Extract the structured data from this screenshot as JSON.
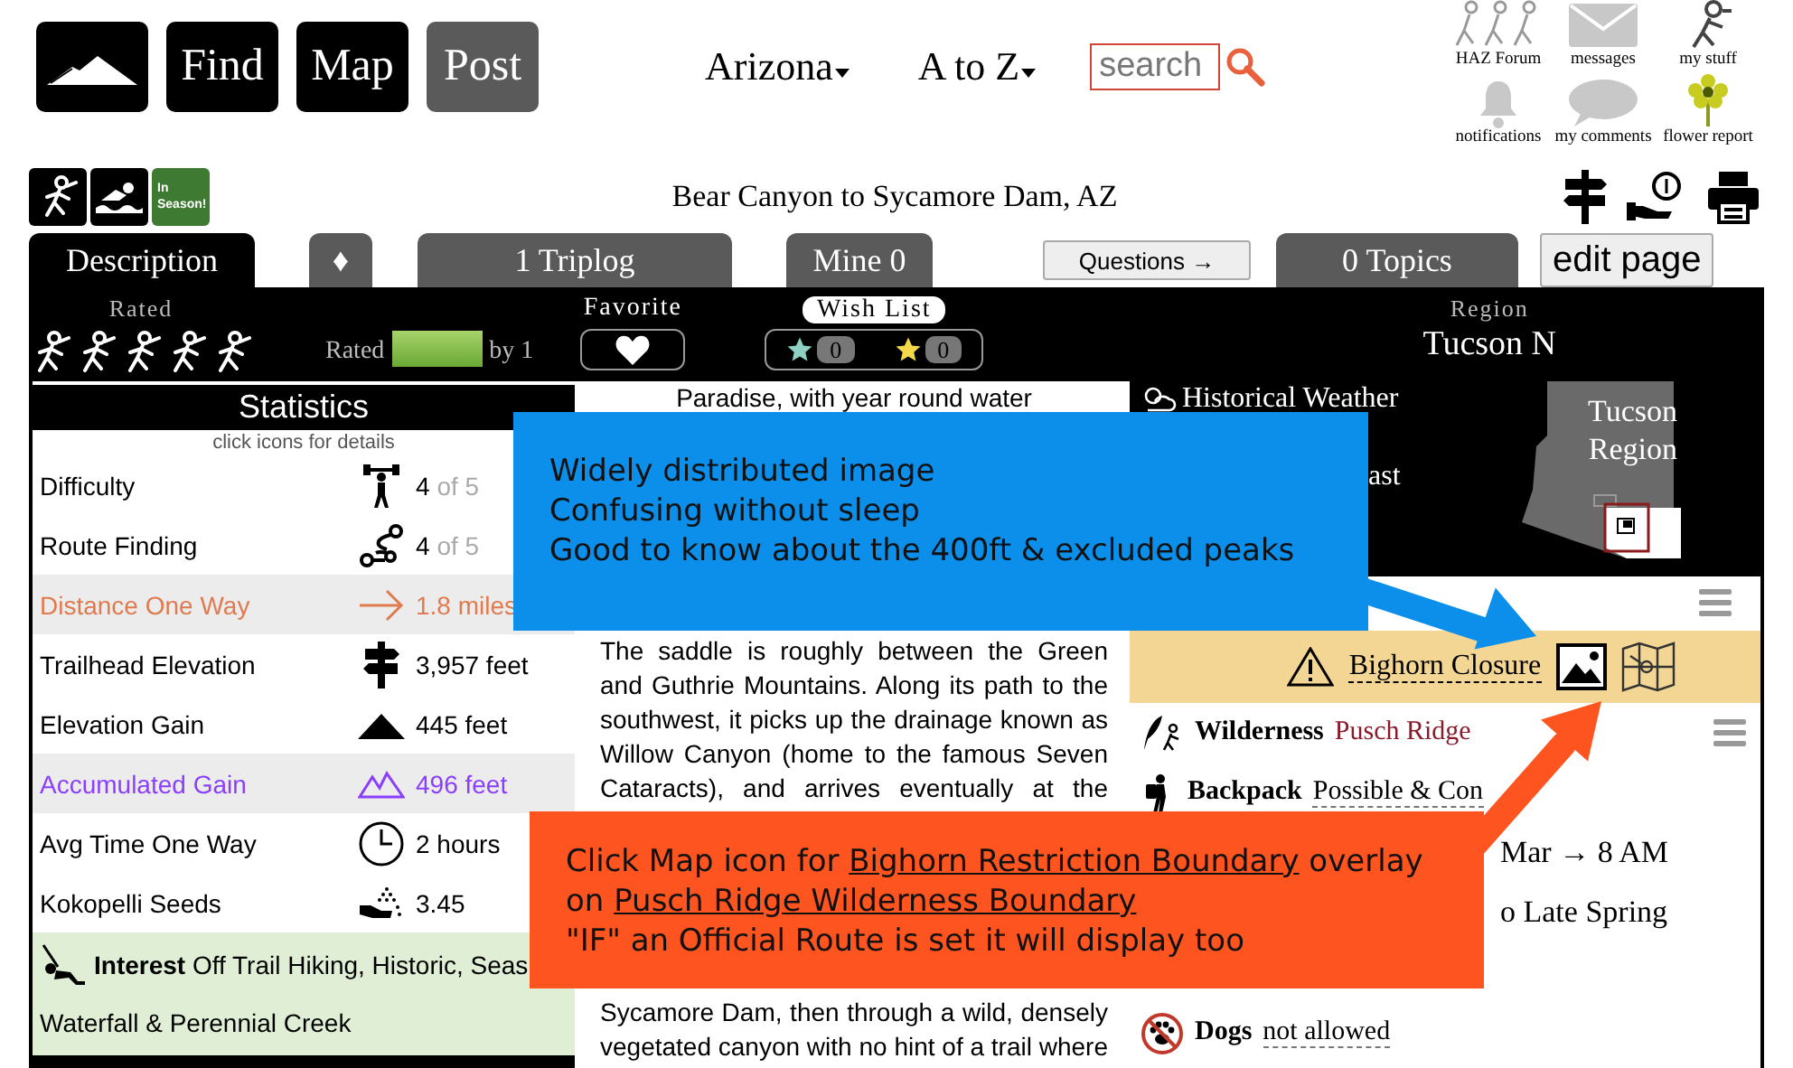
{
  "nav": {
    "buttons": [
      {
        "label": "Find",
        "kind": "primary"
      },
      {
        "label": "Map",
        "kind": "primary"
      },
      {
        "label": "Post",
        "kind": "secondary"
      }
    ],
    "menus": [
      {
        "label": "Arizona"
      },
      {
        "label": "A to Z"
      }
    ],
    "search": {
      "placeholder": "search"
    }
  },
  "shortcuts": [
    {
      "label": "HAZ Forum",
      "kind": "forum"
    },
    {
      "label": "messages",
      "kind": "messages"
    },
    {
      "label": "my stuff",
      "kind": "stuff"
    },
    {
      "label": "notifications",
      "kind": "notifications"
    },
    {
      "label": "my comments",
      "kind": "comments"
    },
    {
      "label": "flower report",
      "kind": "flower"
    }
  ],
  "season_badge": {
    "line1": "In",
    "line2": "Season!"
  },
  "title": "Bear Canyon to Sycamore Dam, AZ",
  "tabs": [
    {
      "label": "Description",
      "kind": "tab",
      "selected": true
    },
    {
      "label": "♦",
      "kind": "tab",
      "selected": false
    },
    {
      "label": "1 Triplog",
      "kind": "tab",
      "selected": false
    },
    {
      "label": "Mine 0",
      "kind": "tab",
      "selected": false
    },
    {
      "label": "Questions →",
      "kind": "button"
    },
    {
      "label": "0 Topics",
      "kind": "tab",
      "selected": false
    },
    {
      "label": "edit page",
      "kind": "button"
    }
  ],
  "summary": {
    "rated_label": "Rated",
    "rating_prefix": "Rated",
    "level": 1,
    "rating_suffix": "by 1",
    "favorite_label": "Favorite",
    "wish_list_label": "Wish List",
    "wish_counts": [
      "0",
      "0"
    ],
    "region_label": "Region",
    "region": "Tucson N"
  },
  "statistics": {
    "title": "Statistics",
    "hint": "click icons for details",
    "rows": [
      {
        "kind": "difficulty",
        "label": "Difficulty",
        "value": "4",
        "scale": "of 5",
        "color": "#000000",
        "shaded": false
      },
      {
        "kind": "route",
        "label": "Route Finding",
        "value": "4",
        "scale": "of 5",
        "color": "#000000",
        "shaded": false
      },
      {
        "kind": "distance",
        "label": "Distance One Way",
        "value": "1.8 miles",
        "color": "#e07a4f",
        "shaded": true
      },
      {
        "kind": "trailhead",
        "label": "Trailhead Elevation",
        "value": "3,957 feet",
        "color": "#000000",
        "shaded": false
      },
      {
        "kind": "gain",
        "label": "Elevation Gain",
        "value": "445 feet",
        "color": "#000000",
        "shaded": false
      },
      {
        "kind": "accumulated",
        "label": "Accumulated Gain",
        "value": "496 feet",
        "color": "#8a3ffc",
        "shaded": true
      },
      {
        "kind": "time",
        "label": "Avg Time One Way",
        "value": "2 hours",
        "color": "#000000",
        "shaded": false
      },
      {
        "kind": "seeds",
        "label": "Kokopelli Seeds",
        "value": "3.45",
        "color": "#000000",
        "shaded": false
      }
    ],
    "interest": {
      "label": "Interest",
      "text": "Off Trail Hiking, Historic, Seas",
      "continued": "Waterfall & Perennial Creek"
    }
  },
  "description": {
    "lead": "Paradise, with year round water",
    "paragraphs": [
      "The saddle is roughly between the Green and Guthrie Mountains. Along its path to the southwest, it picks up the drainage known as Willow Canyon (home to the famous Seven Cataracts), and arrives eventually at the",
      "Sycamore Dam, then through a wild, densely vegetated canyon with no hint of a trail where"
    ]
  },
  "conditions": {
    "weather": "Historical Weather",
    "forecast_fragment": "ast",
    "map_label": "Tucson Region"
  },
  "closure": {
    "label": "Bighorn Closure"
  },
  "details": [
    {
      "kind": "wilderness",
      "label": "Wilderness",
      "value": "Pusch Ridge",
      "menu": true
    },
    {
      "kind": "backpack",
      "label": "Backpack",
      "value": "Possible & Con",
      "menu": false
    },
    {
      "kind": "fragment",
      "value": "Mar → 8 AM"
    },
    {
      "kind": "fragment",
      "value": "o Late Spring"
    },
    {
      "kind": "dogs",
      "label": "Dogs",
      "value": "not allowed",
      "menu": false
    }
  ],
  "annotations": [
    {
      "color": "#0b8fea",
      "lines": [
        [
          {
            "text": "Widely distributed image",
            "link": false
          }
        ],
        [
          {
            "text": "Confusing without sleep",
            "link": false
          }
        ],
        [
          {
            "text": "Good to know about the 400ft & excluded peaks",
            "link": false
          }
        ]
      ]
    },
    {
      "color": "#fe5520",
      "lines": [
        [
          {
            "text": "Click Map icon for ",
            "link": false
          },
          {
            "text": "Bighorn Restriction Boundary",
            "link": true
          },
          {
            "text": " overlay",
            "link": false
          }
        ],
        [
          {
            "text": "on ",
            "link": false
          },
          {
            "text": "Pusch Ridge Wilderness Boundary",
            "link": true
          }
        ],
        [
          {
            "text": "\"IF\" an Official Route is set it will display too",
            "link": false
          }
        ]
      ]
    }
  ]
}
